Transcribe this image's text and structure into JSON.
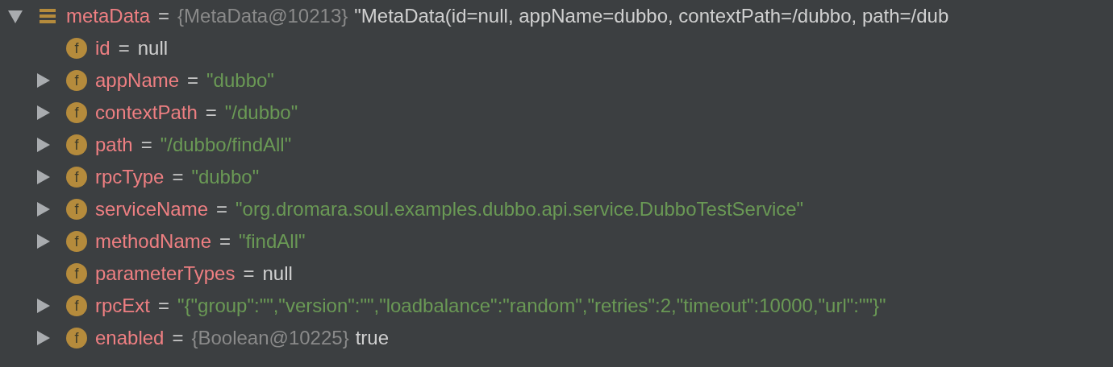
{
  "variables": [
    {
      "name": "metaData",
      "kind": "object",
      "expanded": true,
      "equals": "=",
      "type_tag": "{MetaData@10213}",
      "value": "\"MetaData(id=null, appName=dubbo, contextPath=/dubbo, path=/dub",
      "is_string": false,
      "children": [
        {
          "name": "id",
          "kind": "field",
          "badge": "f",
          "leaf": true,
          "equals": "=",
          "value": "null",
          "is_string": false
        },
        {
          "name": "appName",
          "kind": "field",
          "badge": "f",
          "expanded": false,
          "equals": "=",
          "value": "\"dubbo\"",
          "is_string": true
        },
        {
          "name": "contextPath",
          "kind": "field",
          "badge": "f",
          "expanded": false,
          "equals": "=",
          "value": "\"/dubbo\"",
          "is_string": true
        },
        {
          "name": "path",
          "kind": "field",
          "badge": "f",
          "expanded": false,
          "equals": "=",
          "value": "\"/dubbo/findAll\"",
          "is_string": true
        },
        {
          "name": "rpcType",
          "kind": "field",
          "badge": "f",
          "expanded": false,
          "equals": "=",
          "value": "\"dubbo\"",
          "is_string": true
        },
        {
          "name": "serviceName",
          "kind": "field",
          "badge": "f",
          "expanded": false,
          "equals": "=",
          "value": "\"org.dromara.soul.examples.dubbo.api.service.DubboTestService\"",
          "is_string": true
        },
        {
          "name": "methodName",
          "kind": "field",
          "badge": "f",
          "expanded": false,
          "equals": "=",
          "value": "\"findAll\"",
          "is_string": true
        },
        {
          "name": "parameterTypes",
          "kind": "field",
          "badge": "f",
          "leaf": true,
          "equals": "=",
          "value": "null",
          "is_string": false
        },
        {
          "name": "rpcExt",
          "kind": "field",
          "badge": "f",
          "expanded": false,
          "equals": "=",
          "value": "\"{\"group\":\"\",\"version\":\"\",\"loadbalance\":\"random\",\"retries\":2,\"timeout\":10000,\"url\":\"\"}\"",
          "is_string": true
        },
        {
          "name": "enabled",
          "kind": "field",
          "badge": "f",
          "expanded": false,
          "equals": "=",
          "type_tag": "{Boolean@10225}",
          "value": "true",
          "is_string": false
        }
      ]
    }
  ]
}
